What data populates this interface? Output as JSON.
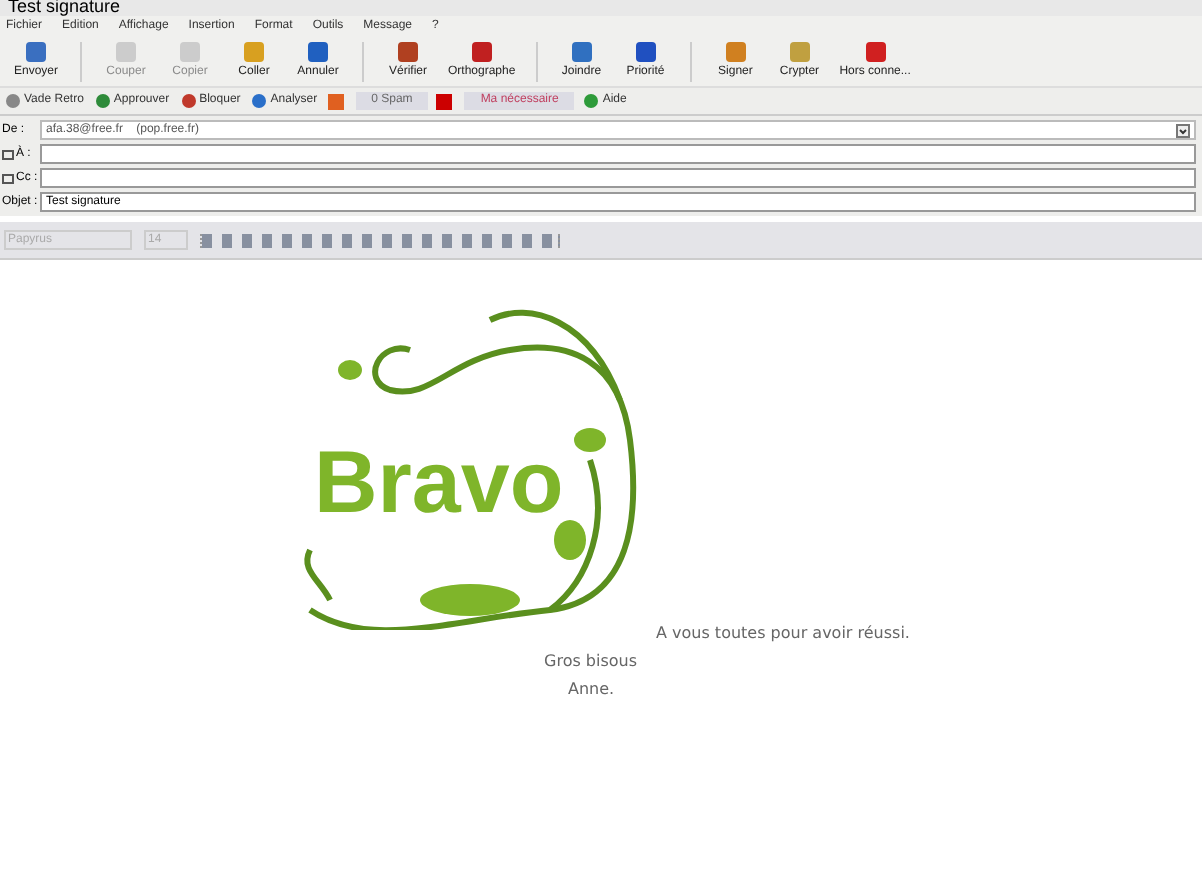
{
  "window": {
    "title": "Test signature"
  },
  "menu": [
    "Fichier",
    "Edition",
    "Affichage",
    "Insertion",
    "Format",
    "Outils",
    "Message",
    "?"
  ],
  "toolbar": [
    {
      "label": "Envoyer",
      "disabled": false
    },
    {
      "label": "Couper",
      "disabled": true
    },
    {
      "label": "Copier",
      "disabled": true
    },
    {
      "label": "Coller",
      "disabled": false
    },
    {
      "label": "Annuler",
      "disabled": false
    },
    {
      "label": "Vérifier",
      "disabled": false
    },
    {
      "label": "Orthographe",
      "disabled": false
    },
    {
      "label": "Joindre",
      "disabled": false
    },
    {
      "label": "Priorité",
      "disabled": false
    },
    {
      "label": "Signer",
      "disabled": false
    },
    {
      "label": "Crypter",
      "disabled": false
    },
    {
      "label": "Hors conne...",
      "disabled": false
    }
  ],
  "spam_bar": [
    {
      "kind": "button",
      "label": "Vade Retro",
      "color": "#888888"
    },
    {
      "kind": "button",
      "label": "Approuver",
      "color": "#2e8b3a"
    },
    {
      "kind": "button",
      "label": "Bloquer",
      "color": "#c0392b"
    },
    {
      "kind": "button",
      "label": "Analyser",
      "color": "#2a6fc9"
    },
    {
      "kind": "status",
      "label": "0 Spam",
      "color": "#e06020"
    },
    {
      "kind": "status",
      "label": "Ma nécessaire",
      "color": "#cc0000"
    },
    {
      "kind": "button",
      "label": "Aide",
      "color": "#2e9b3a"
    }
  ],
  "header": {
    "from_label": "De :",
    "from_value": "afa.38@free.fr    (pop.free.fr)",
    "to_label": "À :",
    "cc_label": "Cc :",
    "subject_label": "Objet :",
    "subject_value": "Test signature"
  },
  "format_bar": {
    "font": "Papyrus",
    "size": "14"
  },
  "body": {
    "image_text": "Bravo",
    "line_1": "A vous toutes pour avoir réussi.",
    "line_2": "Gros bisous",
    "line_3": "Anne."
  }
}
